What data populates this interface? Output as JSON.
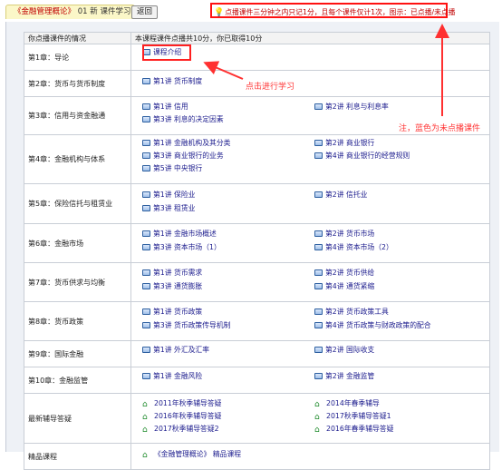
{
  "tab": {
    "course_name": "《金融管理概论》",
    "course_code": "01 新",
    "label": "课件学习"
  },
  "back_button": "返回",
  "notice_text": "点播课件三分钟之内只记1分，且每个课件仅计1次，图示：已点播/未点播",
  "header": {
    "left": "你点播课件的情况",
    "right": "本课程课件点播共10分，你已取得10分"
  },
  "annotations": {
    "click_to_learn": "点击进行学习",
    "note": "注，蓝色为未点播课件"
  },
  "rows": [
    {
      "chapter": "第1章：导论",
      "links": [
        "课程介绍"
      ]
    },
    {
      "chapter": "第2章：货币与货币制度",
      "links": [
        "第1讲 货币制度"
      ]
    },
    {
      "chapter": "第3章：信用与资金融通",
      "links": [
        "第1讲 信用",
        "第2讲 利息与利息率",
        "第3讲 利息的决定因素"
      ]
    },
    {
      "chapter": "第4章：金融机构与体系",
      "links": [
        "第1讲 金融机构及其分类",
        "第2讲 商业银行",
        "第3讲 商业银行的业务",
        "第4讲 商业银行的经营规则",
        "第5讲 中央银行"
      ]
    },
    {
      "chapter": "第5章：保险信托与租赁业",
      "links": [
        "第1讲 保险业",
        "第2讲 信托业",
        "第3讲 租赁业"
      ]
    },
    {
      "chapter": "第6章：金融市场",
      "links": [
        "第1讲 金融市场概述",
        "第2讲 货币市场",
        "第3讲 资本市场（1）",
        "第4讲 资本市场（2）"
      ]
    },
    {
      "chapter": "第7章：货币供求与均衡",
      "links": [
        "第1讲 货币需求",
        "第2讲 货币供给",
        "第3讲 通货膨胀",
        "第4讲 通货紧缩"
      ]
    },
    {
      "chapter": "第8章：货币政策",
      "links": [
        "第1讲 货币政策",
        "第2讲 货币政策工具",
        "第3讲 货币政策传导机制",
        "第4讲 货币政策与财政政策的配合"
      ]
    },
    {
      "chapter": "第9章：国际金融",
      "links": [
        "第1讲 外汇及汇率",
        "第2讲 国际收支"
      ]
    },
    {
      "chapter": "第10章：金融监管",
      "links": [
        "第1讲 金融风险",
        "第2讲 金融监管"
      ]
    },
    {
      "chapter": "最新辅导答疑",
      "links": [
        "2011年秋季辅导答疑",
        "2014年春季辅导",
        "2016年秋季辅导答疑",
        "2017秋季辅导答疑1",
        "2017秋季辅导答疑2",
        "2016年春季辅导答疑"
      ]
    },
    {
      "chapter": "精品课程",
      "links": [
        "《金融管理概论》 精品课程"
      ]
    }
  ]
}
